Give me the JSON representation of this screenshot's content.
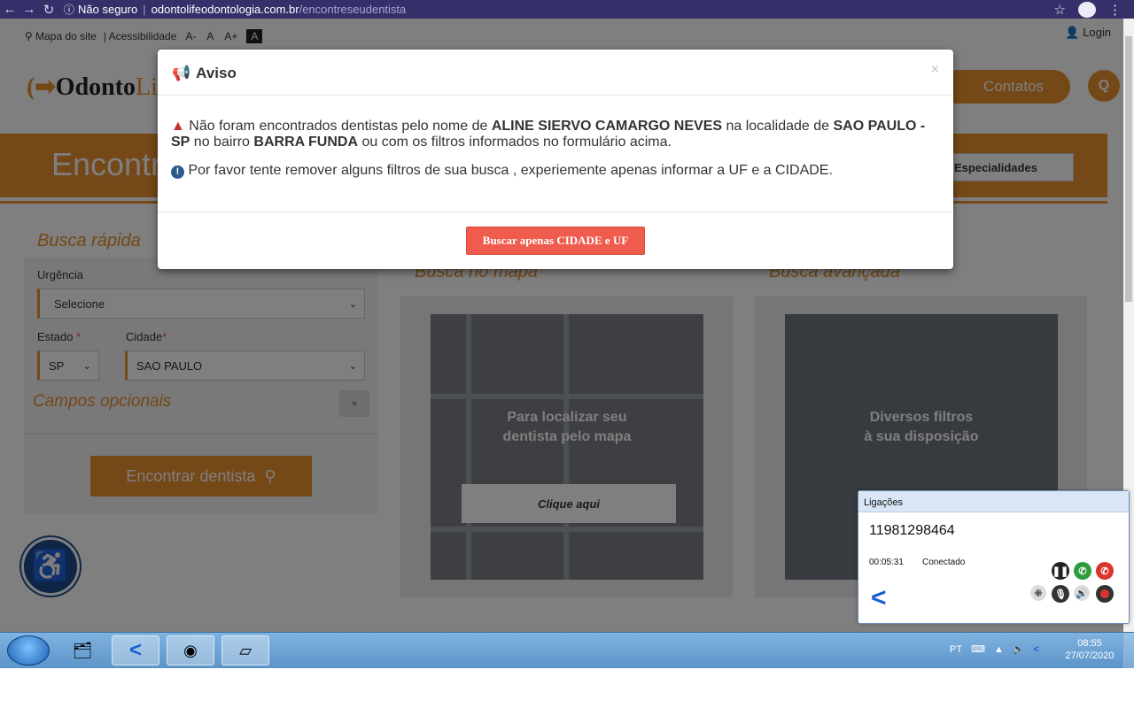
{
  "browser": {
    "not_secure": "Não seguro",
    "host": "odontolifeodontologia.com.br",
    "path": "/encontreseudentista"
  },
  "site": {
    "sitemap": "Mapa do site",
    "accessibility": "| Acessibilidade",
    "font_small": "A-",
    "font_normal": "A",
    "font_large": "A+",
    "contrast": "A",
    "login": "Login",
    "logo_main": "Odonto",
    "logo_accent": "Life",
    "contacts": "Contatos",
    "banner_title": "Encontre",
    "specialties": "Especialidades",
    "quick_search_title": "Busca rápida",
    "urgency_label": "Urgência",
    "urgency_value": "Selecione",
    "state_label": "Estado",
    "state_value": "SP",
    "city_label": "Cidade",
    "city_value": "SAO PAULO",
    "required_mark": "*",
    "optional_fields": "Campos opcionais",
    "find_button": "Encontrar dentista",
    "map_search_title": "Busca no mapa",
    "map_caption_1": "Para localizar seu",
    "map_caption_2": "dentista pelo mapa",
    "map_cta": "Clique aqui",
    "advanced_search_title": "Busca avançada",
    "adv_caption_1": "Diversos filtros",
    "adv_caption_2": "à sua disposição"
  },
  "modal": {
    "title": "Aviso",
    "close": "×",
    "msg1_a": "Não foram encontrados dentistas pelo nome de",
    "msg1_name": "ALINE SIERVO CAMARGO NEVES",
    "msg1_b": "na localidade de",
    "msg1_place": "SAO PAULO - SP",
    "msg1_c": "no bairro",
    "msg1_district": "BARRA FUNDA",
    "msg1_d": "ou com os filtros informados no formulário acima.",
    "msg2": "Por favor tente remover alguns filtros de sua busca , experiemente apenas informar a UF e a CIDADE.",
    "button": "Buscar apenas CIDADE e UF"
  },
  "call_widget": {
    "title": "Ligações",
    "number": "11981298464",
    "duration": "00:05:31",
    "status": "Conectado"
  },
  "taskbar": {
    "lang": "PT",
    "time": "08:55",
    "date": "27/07/2020"
  },
  "colors": {
    "brand_orange": "#e8912e",
    "modal_button": "#ef5c4e",
    "browser_bar": "#35306a"
  }
}
